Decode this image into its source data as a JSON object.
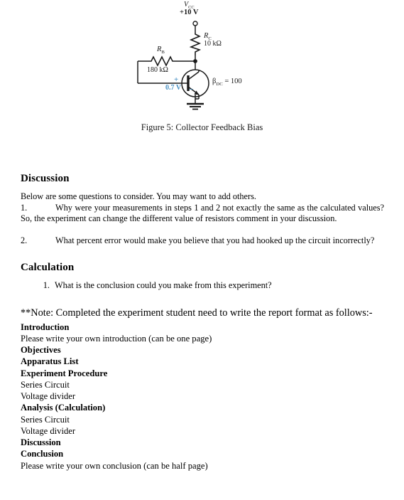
{
  "figure": {
    "caption": "Figure 5: Collector Feedback Bias",
    "circuit": {
      "supply_name": "V",
      "supply_sub": "CC",
      "supply_value": "+10 V",
      "rc_name": "R",
      "rc_sub": "C",
      "rc_value": "10 kΩ",
      "rb_name": "R",
      "rb_sub": "B",
      "rb_value": "180 kΩ",
      "vbe_value": "0.7 V",
      "vbe_plus": "+",
      "vbe_minus": "−",
      "beta_symbol": "β",
      "beta_sub": "DC",
      "beta_value": "= 100",
      "annotation_color": "#4b92c4",
      "line_color": "#1a1a1a"
    }
  },
  "discussion": {
    "heading": "Discussion",
    "intro": "Below are some questions to consider. You may want to add others.",
    "questions": [
      {
        "number": "1.",
        "text": "Why were your measurements in steps 1 and 2 not exactly the same as the calculated values? So, the experiment can change the different value of resistors comment in your discussion."
      },
      {
        "number": "2.",
        "text": "What percent error would make you believe that you had hooked up the circuit incorrectly?"
      }
    ]
  },
  "calculation": {
    "heading": "Calculation",
    "items": [
      "What is the conclusion could you make from this experiment?"
    ]
  },
  "note": {
    "text": "**Note: Completed the experiment student need to write the report format as follows:-",
    "format_items": [
      {
        "label": "Introduction",
        "bold": true
      },
      {
        "label": "Please write your own introduction (can be one page)",
        "bold": false
      },
      {
        "label": "Objectives",
        "bold": true
      },
      {
        "label": "Apparatus List",
        "bold": true
      },
      {
        "label": "Experiment Procedure",
        "bold": true
      },
      {
        "label": "Series Circuit",
        "bold": false
      },
      {
        "label": "Voltage divider",
        "bold": false
      },
      {
        "label": "Analysis (Calculation)",
        "bold": true
      },
      {
        "label": "Series Circuit",
        "bold": false
      },
      {
        "label": "Voltage divider",
        "bold": false
      },
      {
        "label": "Discussion",
        "bold": true
      },
      {
        "label": "Conclusion",
        "bold": true
      },
      {
        "label": "Please write your own conclusion (can be half page)",
        "bold": false
      }
    ]
  }
}
